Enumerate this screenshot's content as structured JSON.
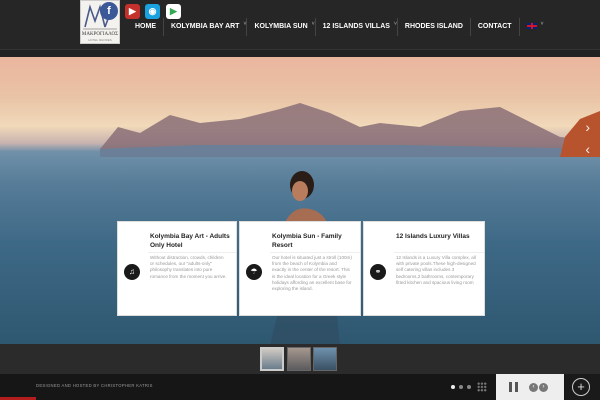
{
  "logo": {
    "text": "ΜΑΚΡΟΓΙΑΛΟΣ",
    "sub": "HOTEL RHODES"
  },
  "social": {
    "facebook": "f",
    "youtube": "▶",
    "tripadvisor": "◉",
    "googleplay": "▶"
  },
  "nav": [
    {
      "label": "HOME",
      "has_sub": false
    },
    {
      "label": "KOLYMBIA BAY ART",
      "has_sub": true
    },
    {
      "label": "KOLYMBIA SUN",
      "has_sub": true
    },
    {
      "label": "12 ISLANDS VILLAS",
      "has_sub": true
    },
    {
      "label": "RHODES ISLAND",
      "has_sub": false
    },
    {
      "label": "CONTACT",
      "has_sub": false
    }
  ],
  "language": {
    "flag": "uk-flag",
    "has_sub": true
  },
  "hero": {
    "next_arrow": "›",
    "prev_arrow": "‹"
  },
  "cards": [
    {
      "title": "Kolymbia Bay Art - Adults Only Hotel",
      "text": "Without distraction, crowds, children or schedules, our \"adults-only\" philosophy translates into pure romance from the moment you arrive.",
      "icon": "music-note-icon",
      "icon_glyph": "♫"
    },
    {
      "title": "Kolymbia Sun - Family Resort",
      "text": "Our hotel is situated just a stroll (100m) from the beach of Kolymbia and exactly in the center of the resort. This is the ideal location for a Greek style holidays affording an excellent base for exploring the island.",
      "icon": "umbrella-icon",
      "icon_glyph": "☂"
    },
    {
      "title": "12 Islands Luxury Villas",
      "text": "12 Islands is a Luxury Villa complex, all with private pools.These high-designed self catering villas includes 3 bedrooms,2 bathrooms, contemporary fitted kitchen and spacious living room",
      "icon": "link-icon",
      "icon_glyph": "⚭"
    }
  ],
  "footer": {
    "credit": "DESIGNED AND HOSTED BY CHRISTOPHER KATRIS",
    "prev": "‹",
    "next": "›",
    "plus": "+"
  }
}
